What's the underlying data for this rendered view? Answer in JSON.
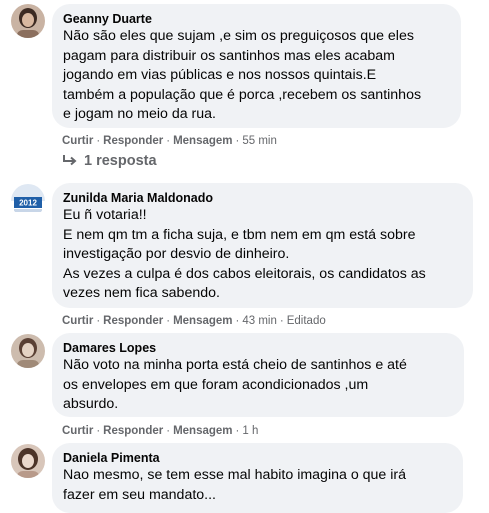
{
  "comments": [
    {
      "author": "Geanny Duarte",
      "text": "Não são eles que sujam ,e sim os preguiçosos que eles\npagam para distribuir os santinhos mas eles acabam\njogando em vias públicas e nos nossos quintais.E\ntambém a população que é porca ,recebem os santinhos\ne jogam no meio da rua.",
      "like_label": "Curtir",
      "reply_label": "Responder",
      "message_label": "Mensagem",
      "time": "55 min",
      "replies_label": "1 resposta",
      "avatar_colors": [
        "#8b6f5e",
        "#3c2a22",
        "#d9b8a0"
      ]
    },
    {
      "author": "Zunilda Maria Maldonado",
      "text": "Eu ñ votaria!!\nE nem qm tm a ficha suja, e tbm nem em qm está sobre\ninvestigação por desvio de dinheiro.\nAs vezes a culpa é dos cabos eleitorais, os candidatos as\nvezes nem fica sabendo.",
      "like_label": "Curtir",
      "reply_label": "Responder",
      "message_label": "Mensagem",
      "time": "43 min",
      "edited_label": "Editado",
      "avatar_colors": [
        "#1f5fa8",
        "#ffffff",
        "#c8d6e8"
      ]
    },
    {
      "author": "Damares Lopes",
      "text": "Não voto na minha porta está cheio de santinhos e até\nos envelopes em que foram acondicionados ,um\nabsurdo.",
      "like_label": "Curtir",
      "reply_label": "Responder",
      "message_label": "Mensagem",
      "time": "1 h",
      "avatar_colors": [
        "#a08a78",
        "#5a4034",
        "#e5d3c4"
      ]
    },
    {
      "author": "Daniela Pimenta",
      "text": "Nao mesmo, se tem esse mal habito imagina o que irá\nfazer em seu mandato...",
      "avatar_colors": [
        "#b89a8a",
        "#4b3328",
        "#ead8cc"
      ]
    }
  ]
}
